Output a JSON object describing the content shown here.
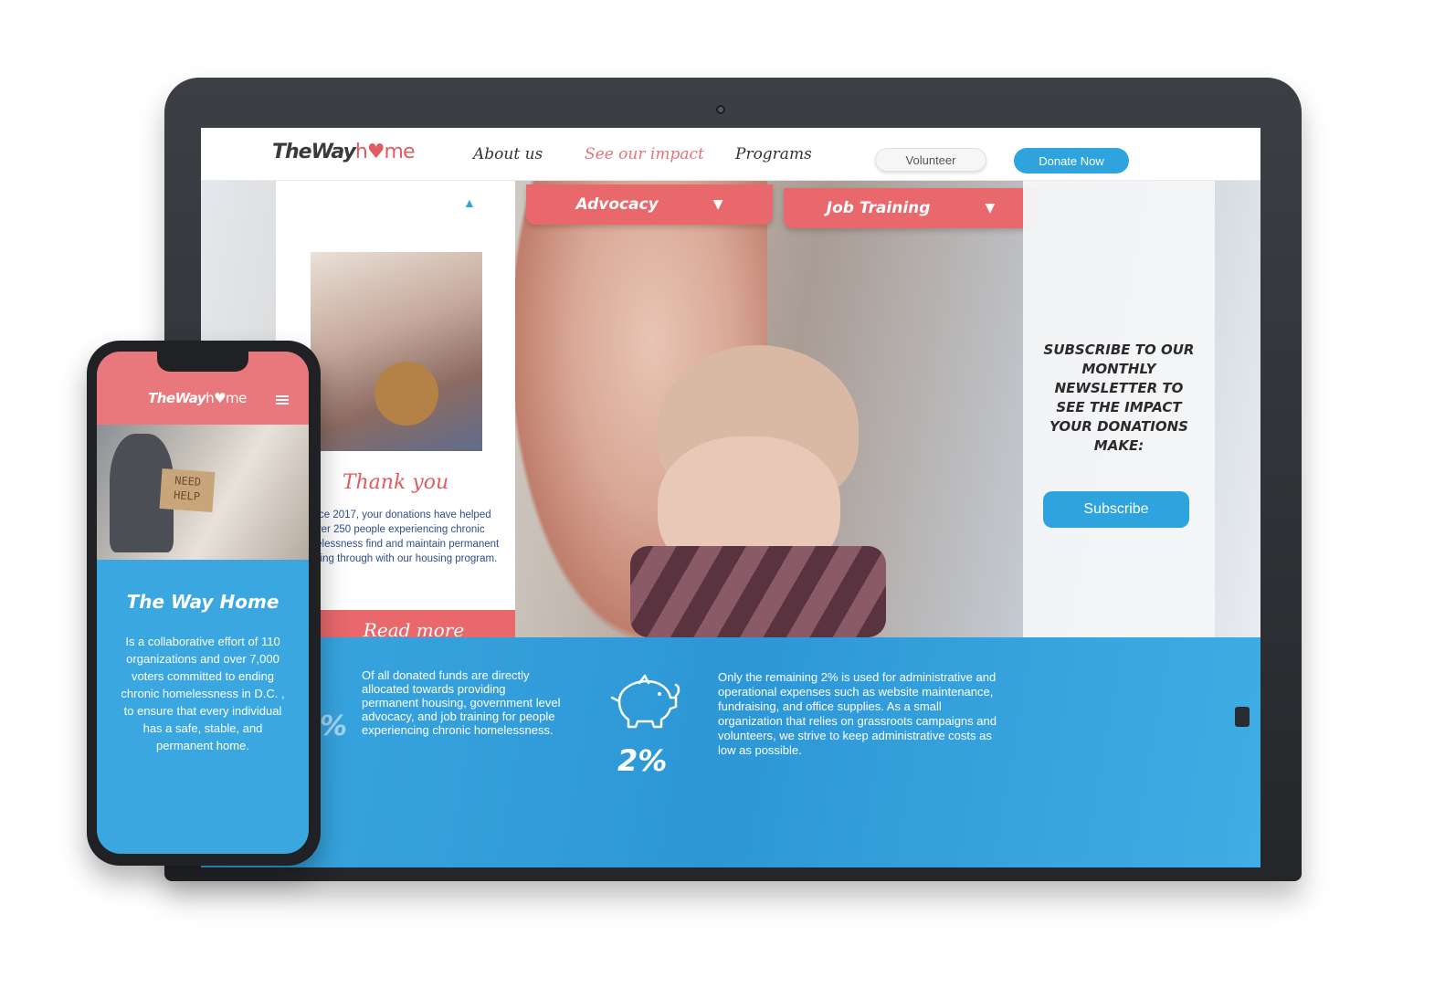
{
  "laptop": {
    "nav": {
      "logo_main": "TheWay",
      "logo_home": "h♥me",
      "links": [
        "About us",
        "See our impact",
        "Programs"
      ],
      "volunteer_label": "Volunteer",
      "donate_label": "Donate Now"
    },
    "dropdowns": [
      {
        "label": "Advocacy",
        "caret": "▼"
      },
      {
        "label": "Job Training",
        "caret": "▼"
      }
    ],
    "card": {
      "caret": "▲",
      "title": "Thank you",
      "body": "Since 2017, your donations have helped over 250 people experiencing chronic homelessness find and maintain permanent housing through with our housing program.",
      "read_more": "Read more"
    },
    "newsletter": {
      "text": "SUBSCRIBE TO OUR MONTHLY NEWSLETTER TO SEE THE IMPACT YOUR DONATIONS MAKE:",
      "subscribe_label": "Subscribe"
    },
    "stats": {
      "left_pct": "%",
      "text_1": "Of all donated funds are directly allocated towards providing permanent housing, government level advocacy, and job training for people experiencing chronic homelessness.",
      "piggy_icon": "piggy-bank-icon",
      "pct_2": "2%",
      "text_2": "Only the remaining 2% is used for administrative and operational expenses such as website maintenance, fundraising, and office supplies. As a small organization that relies on grassroots campaigns and volunteers, we strive to keep administrative costs as low as possible."
    }
  },
  "phone": {
    "logo_main": "TheWay",
    "logo_home": "h♥me",
    "menu_icon": "hamburger-icon",
    "sign_text": "NEED HELP",
    "title": "The Way Home",
    "body": "Is a collaborative effort of 110 organizations and over 7,000 voters committed to ending chronic homelessness in D.C. , to ensure that every individual has a safe, stable, and permanent home."
  },
  "colors": {
    "coral": "#e8686c",
    "blue": "#2ea3dd",
    "text_dark": "#333333"
  }
}
